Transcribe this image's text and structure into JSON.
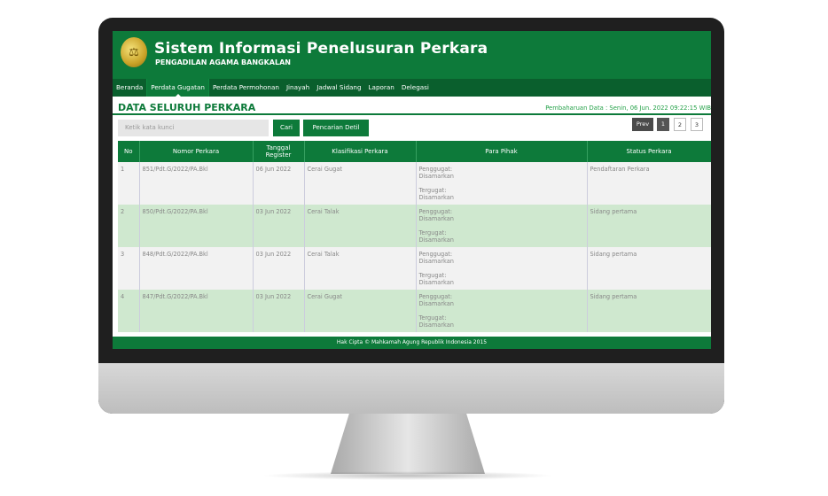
{
  "app": {
    "title": "Sistem Informasi Penelusuran Perkara",
    "subtitle": "PENGADILAN AGAMA BANGKALAN"
  },
  "nav": [
    {
      "label": "Beranda",
      "active": false
    },
    {
      "label": "Perdata Gugatan",
      "active": true
    },
    {
      "label": "Perdata Permohonan",
      "active": false
    },
    {
      "label": "Jinayah",
      "active": false
    },
    {
      "label": "Jadwal Sidang",
      "active": false
    },
    {
      "label": "Laporan",
      "active": false
    },
    {
      "label": "Delegasi",
      "active": false
    }
  ],
  "page": {
    "section_title": "DATA SELURUH PERKARA",
    "update_text": "Pembaharuan Data : Senin, 06 Jun. 2022 09:22:15 WIB"
  },
  "search": {
    "placeholder": "Ketik kata kunci",
    "cari_label": "Cari",
    "detil_label": "Pencarian Detil"
  },
  "pagination": {
    "prev": "Prev",
    "pages": [
      "1",
      "2",
      "3"
    ],
    "current": "1"
  },
  "table": {
    "headers": [
      "No",
      "Nomor Perkara",
      "Tanggal Register",
      "Klasifikasi Perkara",
      "Para Pihak",
      "Status Perkara"
    ],
    "rows": [
      {
        "no": "1",
        "nomor": "851/Pdt.G/2022/PA.Bkl",
        "tanggal": "06 Jun 2022",
        "klasifikasi": "Cerai Gugat",
        "penggugat": "Penggugat:",
        "penggugat_nama": "Disamarkan",
        "tergugat": "Tergugat:",
        "tergugat_nama": "Disamarkan",
        "status": "Pendaftaran Perkara"
      },
      {
        "no": "2",
        "nomor": "850/Pdt.G/2022/PA.Bkl",
        "tanggal": "03 Jun 2022",
        "klasifikasi": "Cerai Talak",
        "penggugat": "Penggugat:",
        "penggugat_nama": "Disamarkan",
        "tergugat": "Tergugat:",
        "tergugat_nama": "Disamarkan",
        "status": "Sidang pertama"
      },
      {
        "no": "3",
        "nomor": "848/Pdt.G/2022/PA.Bkl",
        "tanggal": "03 Jun 2022",
        "klasifikasi": "Cerai Talak",
        "penggugat": "Penggugat:",
        "penggugat_nama": "Disamarkan",
        "tergugat": "Tergugat:",
        "tergugat_nama": "Disamarkan",
        "status": "Sidang pertama"
      },
      {
        "no": "4",
        "nomor": "847/Pdt.G/2022/PA.Bkl",
        "tanggal": "03 Jun 2022",
        "klasifikasi": "Cerai Gugat",
        "penggugat": "Penggugat:",
        "penggugat_nama": "Disamarkan",
        "tergugat": "Tergugat:",
        "tergugat_nama": "Disamarkan",
        "status": "Sidang pertama"
      }
    ]
  },
  "footer": {
    "text": "Hak Cipta © Mahkamah Agung Republik Indonesia 2015"
  },
  "colors": {
    "primary": "#0d7a3a",
    "nav": "#0a5f2d",
    "row_alt": "#cfe8cf"
  }
}
